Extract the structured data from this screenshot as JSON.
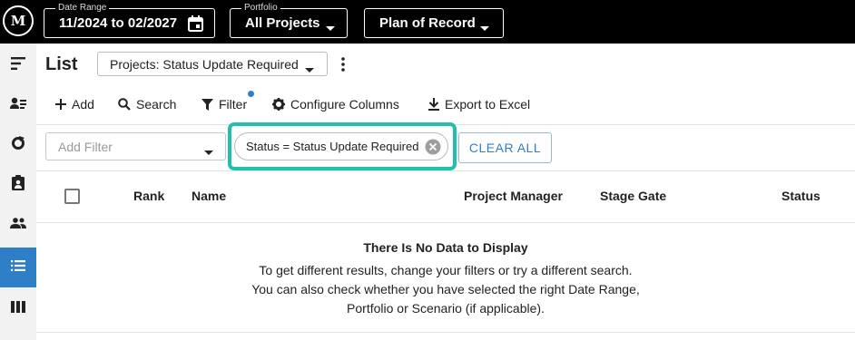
{
  "topbar": {
    "logo_text": "M",
    "date_range": {
      "legend": "Date Range",
      "value": "11/2024 to 02/2027"
    },
    "portfolio": {
      "legend": "Portfolio",
      "value": "All Projects"
    },
    "scenario": {
      "value": "Plan of Record"
    }
  },
  "sidebar": {
    "items": [
      {
        "icon": "menu-lines-icon"
      },
      {
        "icon": "person-list-icon"
      },
      {
        "icon": "cycle-icon"
      },
      {
        "icon": "clipboard-person-icon"
      },
      {
        "icon": "people-icon"
      },
      {
        "icon": "list-icon",
        "active": true
      },
      {
        "icon": "columns-icon"
      }
    ]
  },
  "header": {
    "title": "List",
    "view_select": "Projects: Status Update Required"
  },
  "toolbar": {
    "add": "Add",
    "search": "Search",
    "filter": "Filter",
    "configure_columns": "Configure Columns",
    "export": "Export to Excel"
  },
  "filters": {
    "add_filter_placeholder": "Add Filter",
    "active_chip": "Status = Status Update Required",
    "clear_all": "CLEAR ALL"
  },
  "table": {
    "columns": [
      "Rank",
      "Name",
      "Project Manager",
      "Stage Gate",
      "Status"
    ]
  },
  "empty_state": {
    "title": "There Is No Data to Display",
    "lines": [
      "To get different results, change your filters or try a different search.",
      "You can also check whether you have selected the right Date Range,",
      "Portfolio or Scenario (if applicable)."
    ]
  },
  "colors": {
    "accent": "#2f7ec8",
    "highlight": "#21c0ae",
    "topbar": "#000000",
    "sidebar": "#f2f2f2"
  }
}
